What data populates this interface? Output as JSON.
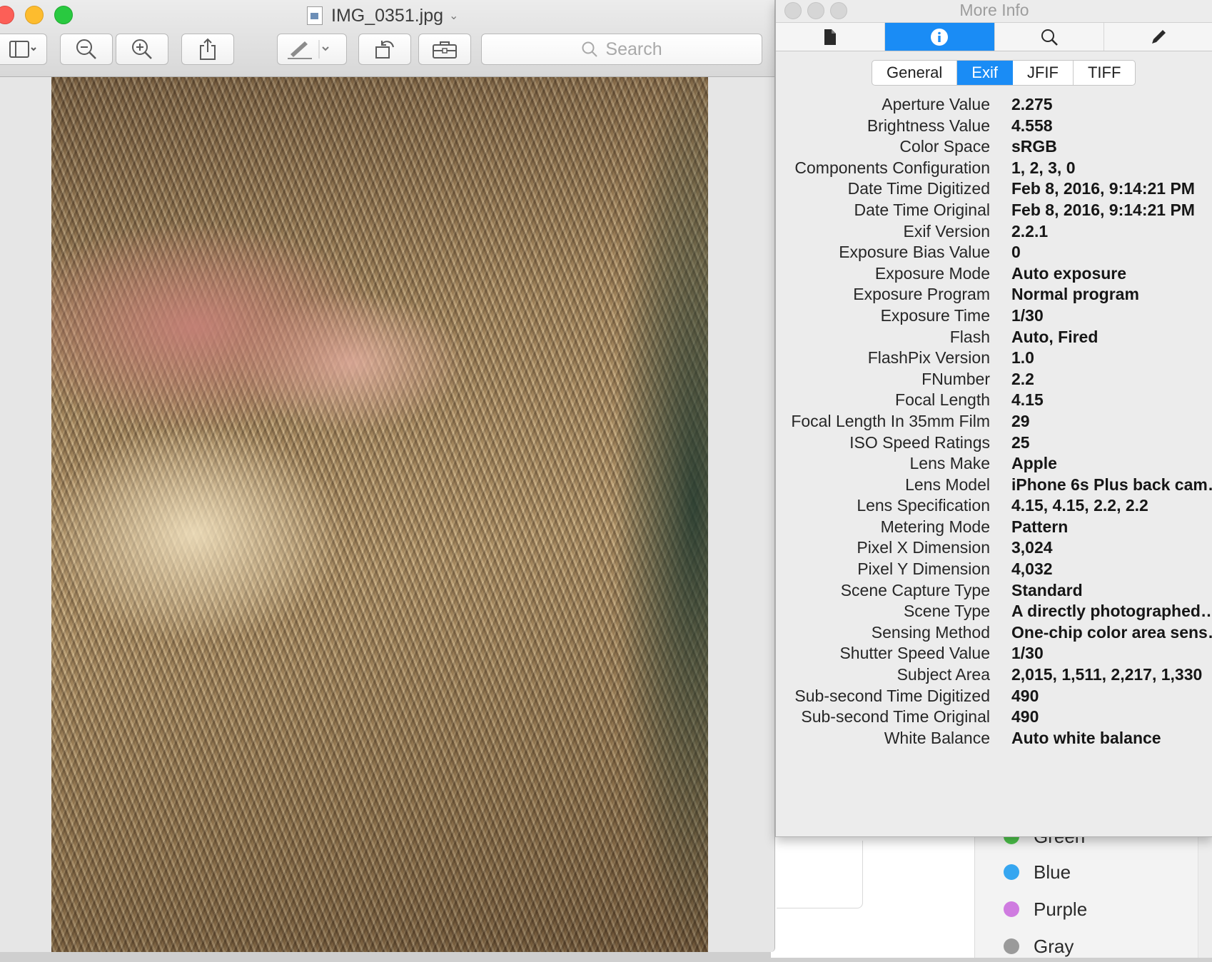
{
  "preview": {
    "title": "IMG_0351.jpg",
    "search_placeholder": "Search",
    "toolbar": [
      "sidebar-toggle",
      "zoom-out",
      "zoom-in",
      "share",
      "markup",
      "rotate",
      "toolbox"
    ]
  },
  "info_panel": {
    "title": "More Info",
    "inspector_tabs": [
      "file-icon",
      "info-icon",
      "search-icon",
      "pencil-icon"
    ],
    "active_inspector_tab": "info-icon",
    "segments": [
      "General",
      "Exif",
      "JFIF",
      "TIFF"
    ],
    "active_segment": "Exif",
    "rows": [
      {
        "key": "Aperture Value",
        "value": "2.275"
      },
      {
        "key": "Brightness Value",
        "value": "4.558"
      },
      {
        "key": "Color Space",
        "value": "sRGB"
      },
      {
        "key": "Components Configuration",
        "value": "1, 2, 3, 0"
      },
      {
        "key": "Date Time Digitized",
        "value": "Feb 8, 2016, 9:14:21 PM"
      },
      {
        "key": "Date Time Original",
        "value": "Feb 8, 2016, 9:14:21 PM"
      },
      {
        "key": "Exif Version",
        "value": "2.2.1"
      },
      {
        "key": "Exposure Bias Value",
        "value": "0"
      },
      {
        "key": "Exposure Mode",
        "value": "Auto exposure"
      },
      {
        "key": "Exposure Program",
        "value": "Normal program"
      },
      {
        "key": "Exposure Time",
        "value": "1/30"
      },
      {
        "key": "Flash",
        "value": "Auto, Fired"
      },
      {
        "key": "FlashPix Version",
        "value": "1.0"
      },
      {
        "key": "FNumber",
        "value": "2.2"
      },
      {
        "key": "Focal Length",
        "value": "4.15"
      },
      {
        "key": "Focal Length In 35mm Film",
        "value": "29"
      },
      {
        "key": "ISO Speed Ratings",
        "value": "25"
      },
      {
        "key": "Lens Make",
        "value": "Apple"
      },
      {
        "key": "Lens Model",
        "value": "iPhone 6s Plus back cam…"
      },
      {
        "key": "Lens Specification",
        "value": "4.15, 4.15, 2.2, 2.2"
      },
      {
        "key": "Metering Mode",
        "value": "Pattern"
      },
      {
        "key": "Pixel X Dimension",
        "value": "3,024"
      },
      {
        "key": "Pixel Y Dimension",
        "value": "4,032"
      },
      {
        "key": "Scene Capture Type",
        "value": "Standard"
      },
      {
        "key": "Scene Type",
        "value": "A directly photographed…"
      },
      {
        "key": "Sensing Method",
        "value": "One-chip color area sens…"
      },
      {
        "key": "Shutter Speed Value",
        "value": "1/30"
      },
      {
        "key": "Subject Area",
        "value": "2,015, 1,511, 2,217, 1,330"
      },
      {
        "key": "Sub-second Time Digitized",
        "value": "490"
      },
      {
        "key": "Sub-second Time Original",
        "value": "490"
      },
      {
        "key": "White Balance",
        "value": "Auto white balance"
      }
    ]
  },
  "tags": [
    {
      "label": "Green",
      "color": "#4cc24a"
    },
    {
      "label": "Blue",
      "color": "#36a6f0"
    },
    {
      "label": "Purple",
      "color": "#cf7be0"
    },
    {
      "label": "Gray",
      "color": "#9a9a9a"
    }
  ],
  "colors": {
    "accent": "#1a8cf5"
  }
}
